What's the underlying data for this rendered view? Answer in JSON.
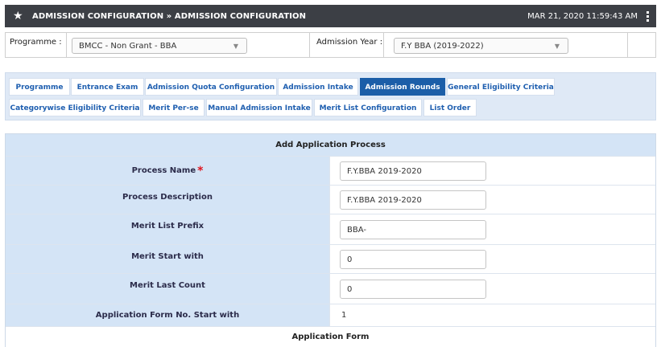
{
  "header": {
    "title": "ADMISSION CONFIGURATION » ADMISSION CONFIGURATION",
    "datetime": "MAR 21, 2020  11:59:43 AM"
  },
  "filters": {
    "programme_label": "Programme :",
    "programme_value": "BMCC - Non Grant - BBA",
    "admission_year_label": "Admission Year :",
    "admission_year_value": "F.Y BBA (2019-2022)"
  },
  "tabs": [
    {
      "label": "Programme",
      "active": false
    },
    {
      "label": "Entrance Exam",
      "active": false
    },
    {
      "label": "Admission Quota Configuration",
      "active": false
    },
    {
      "label": "Admission Intake",
      "active": false
    },
    {
      "label": "Admission Rounds",
      "active": true
    },
    {
      "label": "General Eligibility Criteria",
      "active": false
    },
    {
      "label": "Categorywise Eligibility Criteria",
      "active": false
    },
    {
      "label": "Merit Per-se",
      "active": false
    },
    {
      "label": "Manual Admission Intake",
      "active": false
    },
    {
      "label": "Merit List Configuration",
      "active": false
    },
    {
      "label": "List Order",
      "active": false
    }
  ],
  "form": {
    "heading": "Add Application Process",
    "fields": [
      {
        "label": "Process Name",
        "value": "F.Y.BBA 2019-2020",
        "required": true,
        "required_mark": "*"
      },
      {
        "label": "Process Description",
        "value": "F.Y.BBA 2019-2020"
      },
      {
        "label": "Merit List Prefix",
        "value": "BBA-"
      },
      {
        "label": "Merit Start with",
        "value": "0"
      },
      {
        "label": "Merit Last Count",
        "value": "0"
      },
      {
        "label": "Application Form No. Start with",
        "value": "1"
      }
    ],
    "footer": "Application Form"
  },
  "colors": {
    "header_bg": "#3c3f45",
    "tab_active": "#1b5ea8",
    "tab_text": "#1f5fb0",
    "panel_bg": "#dfe9f6",
    "label_bg": "#d4e4f6",
    "required": "#e0141e"
  },
  "icons": {
    "header_left": "star-icon",
    "header_right": "kebab-menu-icon",
    "dropdown": "caret-down-icon"
  }
}
